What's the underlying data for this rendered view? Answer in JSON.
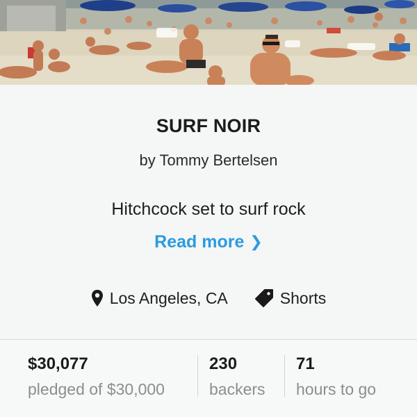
{
  "project": {
    "title": "SURF NOIR",
    "creator": "by Tommy Bertelsen",
    "blurb": "Hitchcock set to surf rock",
    "read_more": "Read more",
    "read_more_icon": "chevron-right-icon",
    "location": "Los Angeles, CA",
    "location_icon": "map-pin-icon",
    "category": "Shorts",
    "category_icon": "tag-icon"
  },
  "stats": {
    "pledged_value": "$30,077",
    "pledged_label": "pledged of $30,000",
    "backers_value": "230",
    "backers_label": "backers",
    "hours_value": "71",
    "hours_label": "hours to go"
  },
  "colors": {
    "accent": "#2b9be0",
    "text": "#1c1c1c",
    "muted": "#8a8e8f",
    "background": "#f5f6f6"
  }
}
